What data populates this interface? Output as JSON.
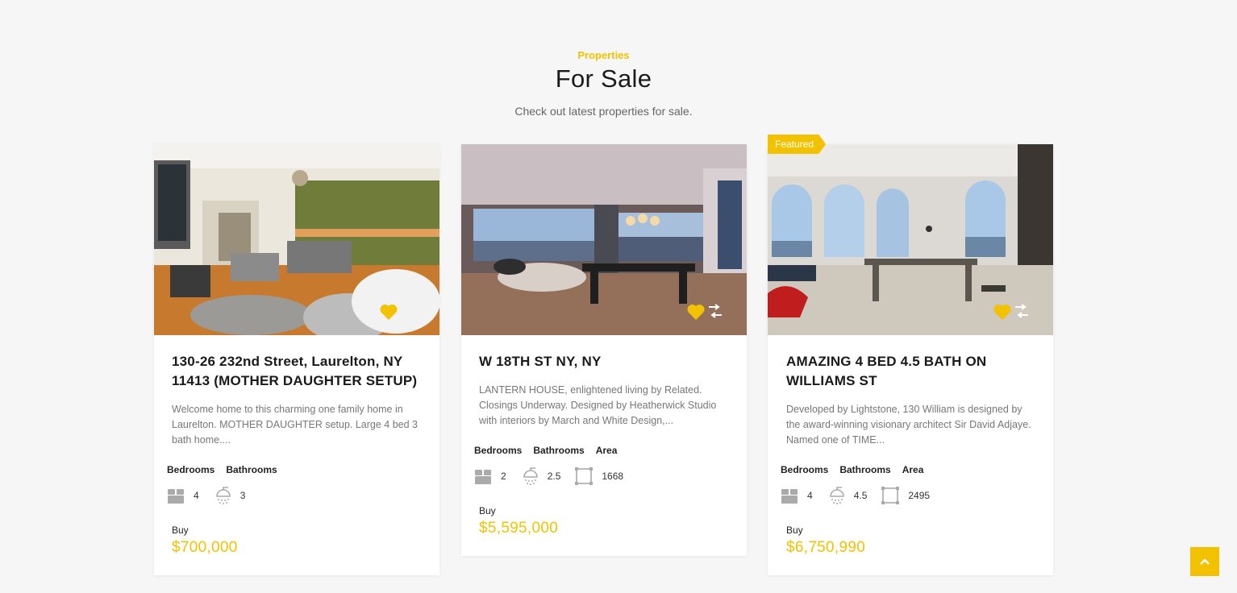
{
  "header": {
    "eyebrow": "Properties",
    "title": "For Sale",
    "subtitle": "Check out latest properties for sale."
  },
  "colors": {
    "accent": "#f2c200",
    "background": "#f6f6f6"
  },
  "labels": {
    "bedrooms": "Bedrooms",
    "bathrooms": "Bathrooms",
    "area": "Area",
    "buy": "Buy",
    "featured": "Featured"
  },
  "icons": [
    "heart-icon",
    "compare-arrows-icon",
    "bed-icon",
    "shower-icon",
    "area-icon",
    "chevron-up-icon"
  ],
  "listings": [
    {
      "title": "130-26 232nd Street, Laurelton, NY 11413 (MOTHER DAUGHTER SETUP)",
      "description": "Welcome home to this charming one family home in Laurelton. MOTHER DAUGHTER setup. Large 4 bed 3 bath home....",
      "bedrooms": "4",
      "bathrooms": "3",
      "status": "Buy",
      "price": "$700,000"
    },
    {
      "title": "W 18TH ST NY, NY",
      "description": "LANTERN HOUSE, enlightened living by Related. Closings Underway. Designed by Heatherwick Studio with interiors by March and White Design,...",
      "bedrooms": "2",
      "bathrooms": "2.5",
      "area": "1668",
      "status": "Buy",
      "price": "$5,595,000"
    },
    {
      "title": "AMAZING 4 BED 4.5 BATH ON WILLIAMS ST",
      "description": "Developed by Lightstone, 130 William is designed by the award-winning visionary architect Sir David Adjaye. Named one of TIME...",
      "bedrooms": "4",
      "bathrooms": "4.5",
      "area": "2495",
      "status": "Buy",
      "price": "$6,750,990",
      "badge": "Featured"
    }
  ]
}
